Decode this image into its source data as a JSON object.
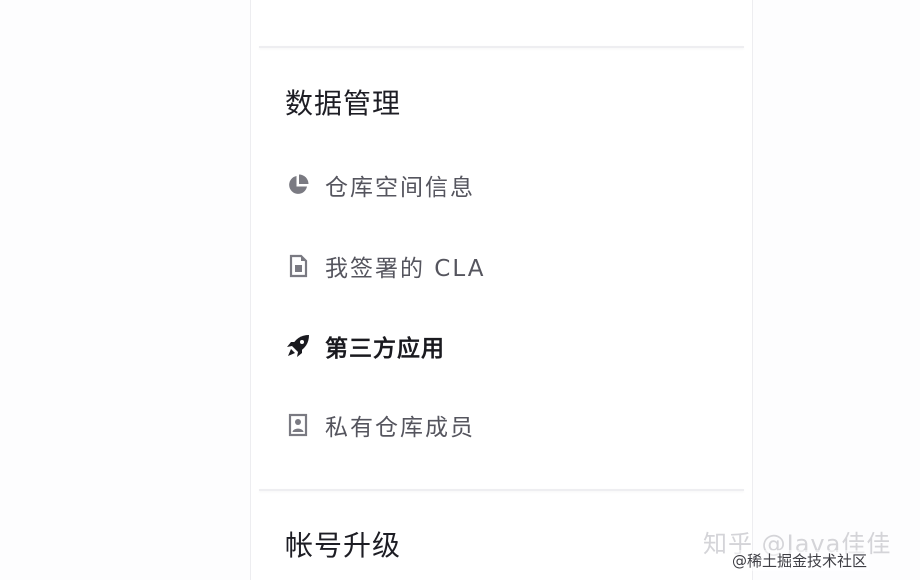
{
  "sections": {
    "data_management": {
      "title": "数据管理",
      "items": [
        {
          "label": "仓库空间信息",
          "icon": "pie-chart-icon",
          "active": false
        },
        {
          "label": "我签署的 CLA",
          "icon": "document-icon",
          "active": false
        },
        {
          "label": "第三方应用",
          "icon": "rocket-icon",
          "active": true
        },
        {
          "label": "私有仓库成员",
          "icon": "member-card-icon",
          "active": false
        }
      ]
    },
    "account_upgrade": {
      "title": "帐号升级"
    }
  },
  "watermark": {
    "main": "知乎 @Java佳佳",
    "sub": "@稀土掘金技术社区"
  },
  "colors": {
    "text_primary": "#1d1d24",
    "text_muted": "#55555e",
    "icon_muted": "#7a7a82",
    "icon_active": "#1a1a1f",
    "divider": "#eeeef1"
  }
}
